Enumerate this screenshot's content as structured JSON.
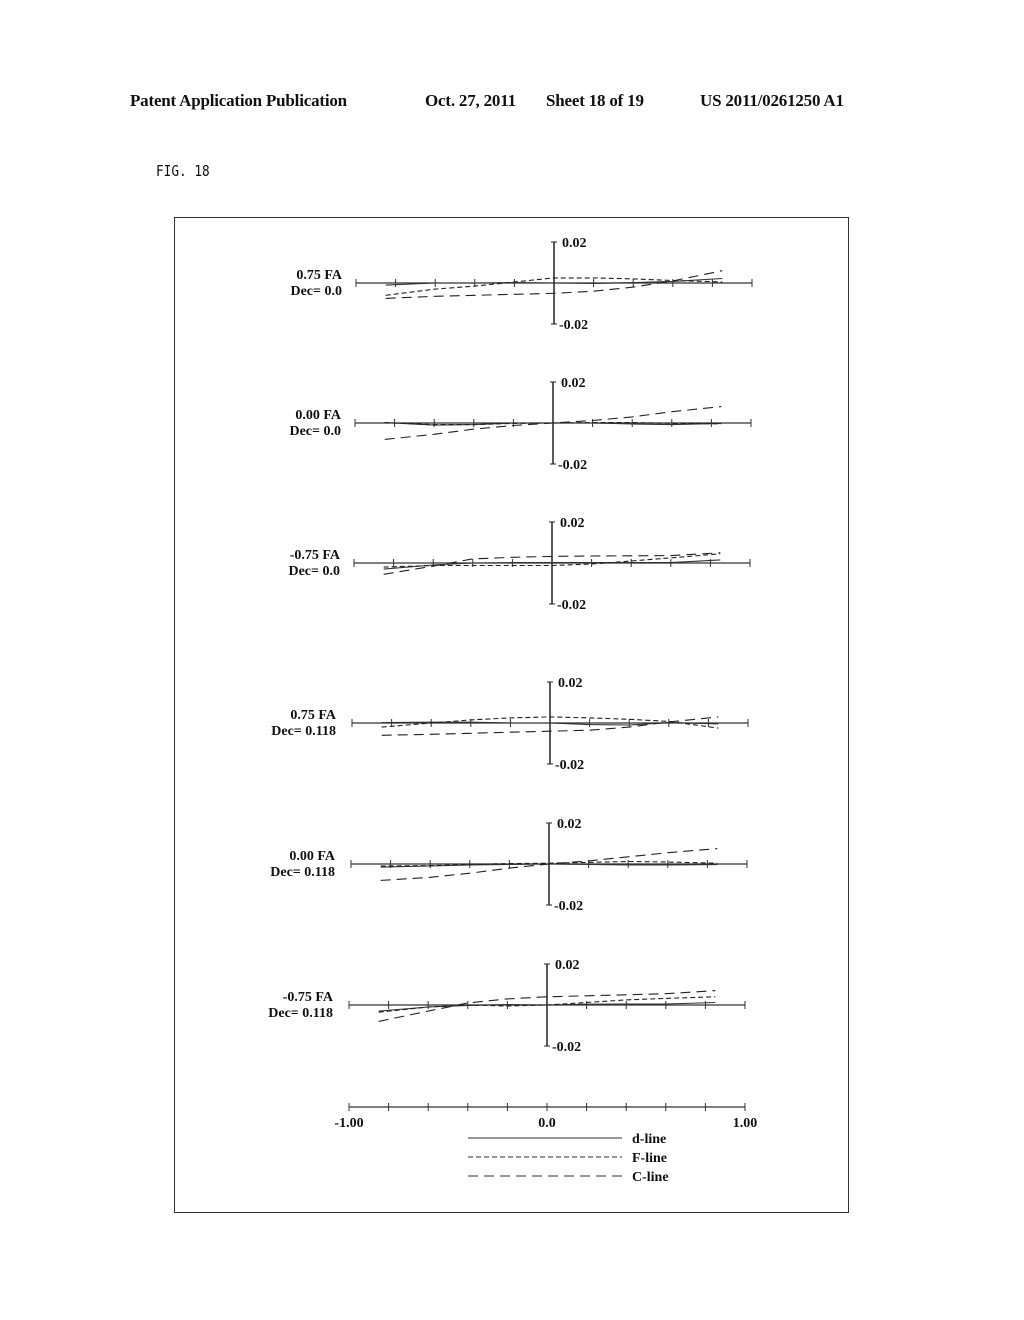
{
  "header": {
    "left": "Patent Application Publication",
    "date": "Oct. 27, 2011",
    "sheet": "Sheet 18 of 19",
    "number": "US 2011/0261250 A1"
  },
  "figure": {
    "label": "FIG. 18"
  },
  "chart_data": {
    "type": "line",
    "title": "FIG. 18",
    "xlabel": "",
    "ylabel": "",
    "x_ticks": [
      "-1.00",
      "0.0",
      "1.00"
    ],
    "xlim": [
      -1.0,
      1.0
    ],
    "ylim": [
      -0.02,
      0.02
    ],
    "y_tick_top": "0.02",
    "y_tick_bottom": "-0.02",
    "legend": [
      {
        "name": "d-line",
        "style": "solid"
      },
      {
        "name": "F-line",
        "style": "short-dash"
      },
      {
        "name": "C-line",
        "style": "long-dash"
      }
    ],
    "legend_placement": "bottom-center",
    "x": [
      -0.85,
      -0.6,
      -0.4,
      -0.2,
      0.0,
      0.2,
      0.4,
      0.6,
      0.85
    ],
    "panels": [
      {
        "field": "0.75 FA",
        "dec": "Dec= 0.0",
        "series": [
          {
            "name": "d-line",
            "values": [
              -0.001,
              0.0,
              0.0,
              0.0002,
              0.0,
              -0.0002,
              0.0002,
              0.0008,
              0.0022
            ]
          },
          {
            "name": "F-line",
            "values": [
              -0.006,
              -0.003,
              -0.0015,
              0.0005,
              0.0025,
              0.0025,
              0.002,
              0.0012,
              0.0005
            ]
          },
          {
            "name": "C-line",
            "values": [
              -0.0075,
              -0.0065,
              -0.006,
              -0.0055,
              -0.005,
              -0.004,
              -0.002,
              0.001,
              0.006
            ]
          }
        ]
      },
      {
        "field": "0.00 FA",
        "dec": "Dec= 0.0",
        "series": [
          {
            "name": "d-line",
            "values": [
              0.0002,
              -0.001,
              -0.0008,
              0.0,
              0.0,
              0.0,
              -0.0005,
              -0.0008,
              -0.0002
            ]
          },
          {
            "name": "F-line",
            "values": [
              0.0002,
              -0.0008,
              -0.0008,
              -0.0002,
              0.0,
              0.0002,
              0.0002,
              -0.0002,
              -0.0004
            ]
          },
          {
            "name": "C-line",
            "values": [
              -0.008,
              -0.0055,
              -0.003,
              -0.0012,
              0.0,
              0.0012,
              0.003,
              0.0055,
              0.008
            ]
          }
        ]
      },
      {
        "field": "-0.75 FA",
        "dec": "Dec= 0.0",
        "series": [
          {
            "name": "d-line",
            "values": [
              -0.003,
              -0.001,
              0.0,
              0.0002,
              0.0002,
              0.0002,
              0.0002,
              0.0002,
              0.0015
            ]
          },
          {
            "name": "F-line",
            "values": [
              -0.002,
              -0.0012,
              -0.0012,
              -0.0012,
              -0.0012,
              -0.0005,
              0.001,
              0.0025,
              0.0045
            ]
          },
          {
            "name": "C-line",
            "values": [
              -0.0055,
              -0.0015,
              0.002,
              0.0028,
              0.0032,
              0.0034,
              0.0035,
              0.0036,
              0.005
            ]
          }
        ]
      },
      {
        "field": "0.75 FA",
        "dec": "Dec= 0.118",
        "series": [
          {
            "name": "d-line",
            "values": [
              0.0002,
              0.0004,
              0.0004,
              0.0,
              0.0,
              -0.0008,
              -0.001,
              0.0002,
              -0.0005
            ]
          },
          {
            "name": "F-line",
            "values": [
              -0.002,
              0.0,
              0.0015,
              0.0025,
              0.003,
              0.0025,
              0.0018,
              0.0008,
              -0.0025
            ]
          },
          {
            "name": "C-line",
            "values": [
              -0.006,
              -0.0055,
              -0.005,
              -0.0045,
              -0.004,
              -0.0035,
              -0.002,
              0.0005,
              0.003
            ]
          }
        ]
      },
      {
        "field": "0.00 FA",
        "dec": "Dec= 0.118",
        "series": [
          {
            "name": "d-line",
            "values": [
              -0.0015,
              -0.001,
              -0.0005,
              -0.0002,
              0.0,
              -0.0002,
              -0.0005,
              -0.0005,
              -0.0003
            ]
          },
          {
            "name": "F-line",
            "values": [
              -0.001,
              -0.0008,
              -0.0002,
              0.0002,
              0.0004,
              0.0008,
              0.0012,
              0.001,
              0.0004
            ]
          },
          {
            "name": "C-line",
            "values": [
              -0.008,
              -0.0065,
              -0.0045,
              -0.002,
              0.0,
              0.0015,
              0.0035,
              0.0055,
              0.0075
            ]
          }
        ]
      },
      {
        "field": "-0.75 FA",
        "dec": "Dec= 0.118",
        "series": [
          {
            "name": "d-line",
            "values": [
              -0.003,
              -0.001,
              -0.0002,
              0.0002,
              0.0,
              0.0004,
              0.0005,
              0.0005,
              0.0012
            ]
          },
          {
            "name": "F-line",
            "values": [
              -0.0035,
              -0.001,
              0.0,
              -0.0005,
              0.0,
              0.0012,
              0.0025,
              0.0032,
              0.004
            ]
          },
          {
            "name": "C-line",
            "values": [
              -0.008,
              -0.003,
              0.001,
              0.003,
              0.004,
              0.0045,
              0.005,
              0.0055,
              0.007
            ]
          }
        ]
      }
    ]
  }
}
